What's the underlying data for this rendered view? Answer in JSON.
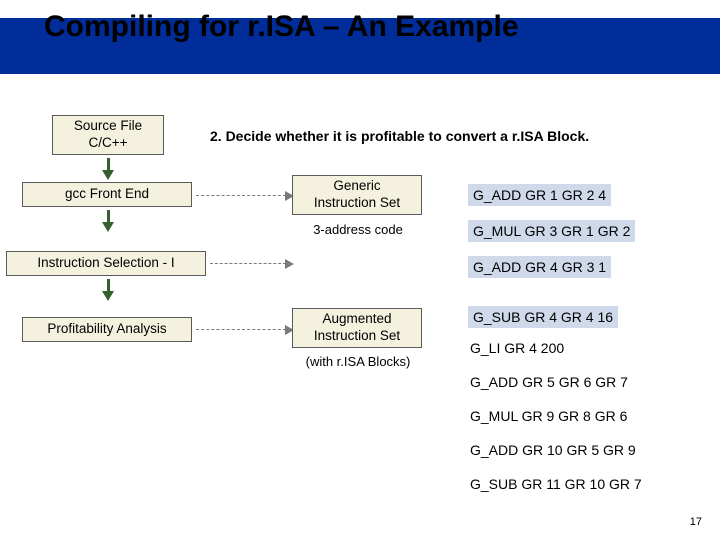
{
  "title": "Compiling for r.ISA – An Example",
  "subtitle": "2. Decide whether it is profitable to convert a r.ISA Block.",
  "pipeline": {
    "source": "Source File\nC/C++",
    "stage1": "gcc Front End",
    "stage2": "Instruction Selection - I",
    "stage3": "Profitability Analysis"
  },
  "middle": {
    "generic_label": "Generic\nInstruction Set",
    "generic_sub": "3-address code",
    "augmented_label": "Augmented\nInstruction Set",
    "augmented_sub": "(with r.ISA Blocks)"
  },
  "code": [
    "G_ADD GR 1 GR 2 4",
    "G_MUL GR 3 GR 1 GR 2",
    "G_ADD GR 4 GR 3 1",
    "G_SUB GR 4 GR 4 16",
    "G_LI GR 4 200",
    "G_ADD GR 5 GR 6 GR 7",
    "G_MUL GR 9 GR 8 GR 6",
    "G_ADD GR 10 GR 5 GR 9",
    "G_SUB GR 11 GR 10 GR 7"
  ],
  "highlighted_code_indices": [
    0,
    1,
    2,
    3
  ],
  "page_number": "17"
}
